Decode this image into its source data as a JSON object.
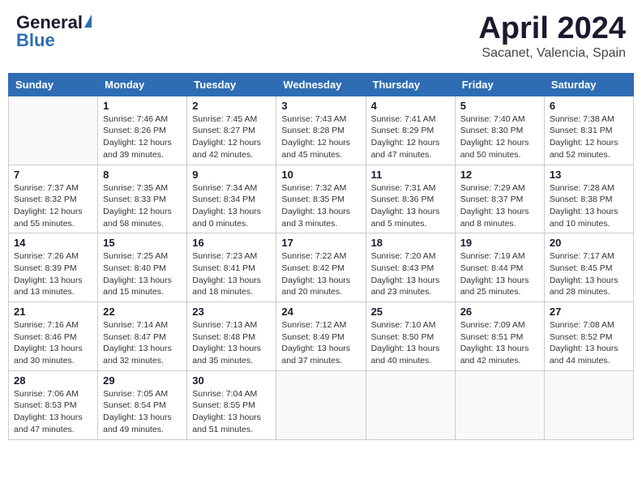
{
  "header": {
    "logo_general": "General",
    "logo_blue": "Blue",
    "month_title": "April 2024",
    "location": "Sacanet, Valencia, Spain"
  },
  "days_of_week": [
    "Sunday",
    "Monday",
    "Tuesday",
    "Wednesday",
    "Thursday",
    "Friday",
    "Saturday"
  ],
  "weeks": [
    [
      {
        "day": "",
        "info": ""
      },
      {
        "day": "1",
        "info": "Sunrise: 7:46 AM\nSunset: 8:26 PM\nDaylight: 12 hours\nand 39 minutes."
      },
      {
        "day": "2",
        "info": "Sunrise: 7:45 AM\nSunset: 8:27 PM\nDaylight: 12 hours\nand 42 minutes."
      },
      {
        "day": "3",
        "info": "Sunrise: 7:43 AM\nSunset: 8:28 PM\nDaylight: 12 hours\nand 45 minutes."
      },
      {
        "day": "4",
        "info": "Sunrise: 7:41 AM\nSunset: 8:29 PM\nDaylight: 12 hours\nand 47 minutes."
      },
      {
        "day": "5",
        "info": "Sunrise: 7:40 AM\nSunset: 8:30 PM\nDaylight: 12 hours\nand 50 minutes."
      },
      {
        "day": "6",
        "info": "Sunrise: 7:38 AM\nSunset: 8:31 PM\nDaylight: 12 hours\nand 52 minutes."
      }
    ],
    [
      {
        "day": "7",
        "info": "Sunrise: 7:37 AM\nSunset: 8:32 PM\nDaylight: 12 hours\nand 55 minutes."
      },
      {
        "day": "8",
        "info": "Sunrise: 7:35 AM\nSunset: 8:33 PM\nDaylight: 12 hours\nand 58 minutes."
      },
      {
        "day": "9",
        "info": "Sunrise: 7:34 AM\nSunset: 8:34 PM\nDaylight: 13 hours\nand 0 minutes."
      },
      {
        "day": "10",
        "info": "Sunrise: 7:32 AM\nSunset: 8:35 PM\nDaylight: 13 hours\nand 3 minutes."
      },
      {
        "day": "11",
        "info": "Sunrise: 7:31 AM\nSunset: 8:36 PM\nDaylight: 13 hours\nand 5 minutes."
      },
      {
        "day": "12",
        "info": "Sunrise: 7:29 AM\nSunset: 8:37 PM\nDaylight: 13 hours\nand 8 minutes."
      },
      {
        "day": "13",
        "info": "Sunrise: 7:28 AM\nSunset: 8:38 PM\nDaylight: 13 hours\nand 10 minutes."
      }
    ],
    [
      {
        "day": "14",
        "info": "Sunrise: 7:26 AM\nSunset: 8:39 PM\nDaylight: 13 hours\nand 13 minutes."
      },
      {
        "day": "15",
        "info": "Sunrise: 7:25 AM\nSunset: 8:40 PM\nDaylight: 13 hours\nand 15 minutes."
      },
      {
        "day": "16",
        "info": "Sunrise: 7:23 AM\nSunset: 8:41 PM\nDaylight: 13 hours\nand 18 minutes."
      },
      {
        "day": "17",
        "info": "Sunrise: 7:22 AM\nSunset: 8:42 PM\nDaylight: 13 hours\nand 20 minutes."
      },
      {
        "day": "18",
        "info": "Sunrise: 7:20 AM\nSunset: 8:43 PM\nDaylight: 13 hours\nand 23 minutes."
      },
      {
        "day": "19",
        "info": "Sunrise: 7:19 AM\nSunset: 8:44 PM\nDaylight: 13 hours\nand 25 minutes."
      },
      {
        "day": "20",
        "info": "Sunrise: 7:17 AM\nSunset: 8:45 PM\nDaylight: 13 hours\nand 28 minutes."
      }
    ],
    [
      {
        "day": "21",
        "info": "Sunrise: 7:16 AM\nSunset: 8:46 PM\nDaylight: 13 hours\nand 30 minutes."
      },
      {
        "day": "22",
        "info": "Sunrise: 7:14 AM\nSunset: 8:47 PM\nDaylight: 13 hours\nand 32 minutes."
      },
      {
        "day": "23",
        "info": "Sunrise: 7:13 AM\nSunset: 8:48 PM\nDaylight: 13 hours\nand 35 minutes."
      },
      {
        "day": "24",
        "info": "Sunrise: 7:12 AM\nSunset: 8:49 PM\nDaylight: 13 hours\nand 37 minutes."
      },
      {
        "day": "25",
        "info": "Sunrise: 7:10 AM\nSunset: 8:50 PM\nDaylight: 13 hours\nand 40 minutes."
      },
      {
        "day": "26",
        "info": "Sunrise: 7:09 AM\nSunset: 8:51 PM\nDaylight: 13 hours\nand 42 minutes."
      },
      {
        "day": "27",
        "info": "Sunrise: 7:08 AM\nSunset: 8:52 PM\nDaylight: 13 hours\nand 44 minutes."
      }
    ],
    [
      {
        "day": "28",
        "info": "Sunrise: 7:06 AM\nSunset: 8:53 PM\nDaylight: 13 hours\nand 47 minutes."
      },
      {
        "day": "29",
        "info": "Sunrise: 7:05 AM\nSunset: 8:54 PM\nDaylight: 13 hours\nand 49 minutes."
      },
      {
        "day": "30",
        "info": "Sunrise: 7:04 AM\nSunset: 8:55 PM\nDaylight: 13 hours\nand 51 minutes."
      },
      {
        "day": "",
        "info": ""
      },
      {
        "day": "",
        "info": ""
      },
      {
        "day": "",
        "info": ""
      },
      {
        "day": "",
        "info": ""
      }
    ]
  ]
}
